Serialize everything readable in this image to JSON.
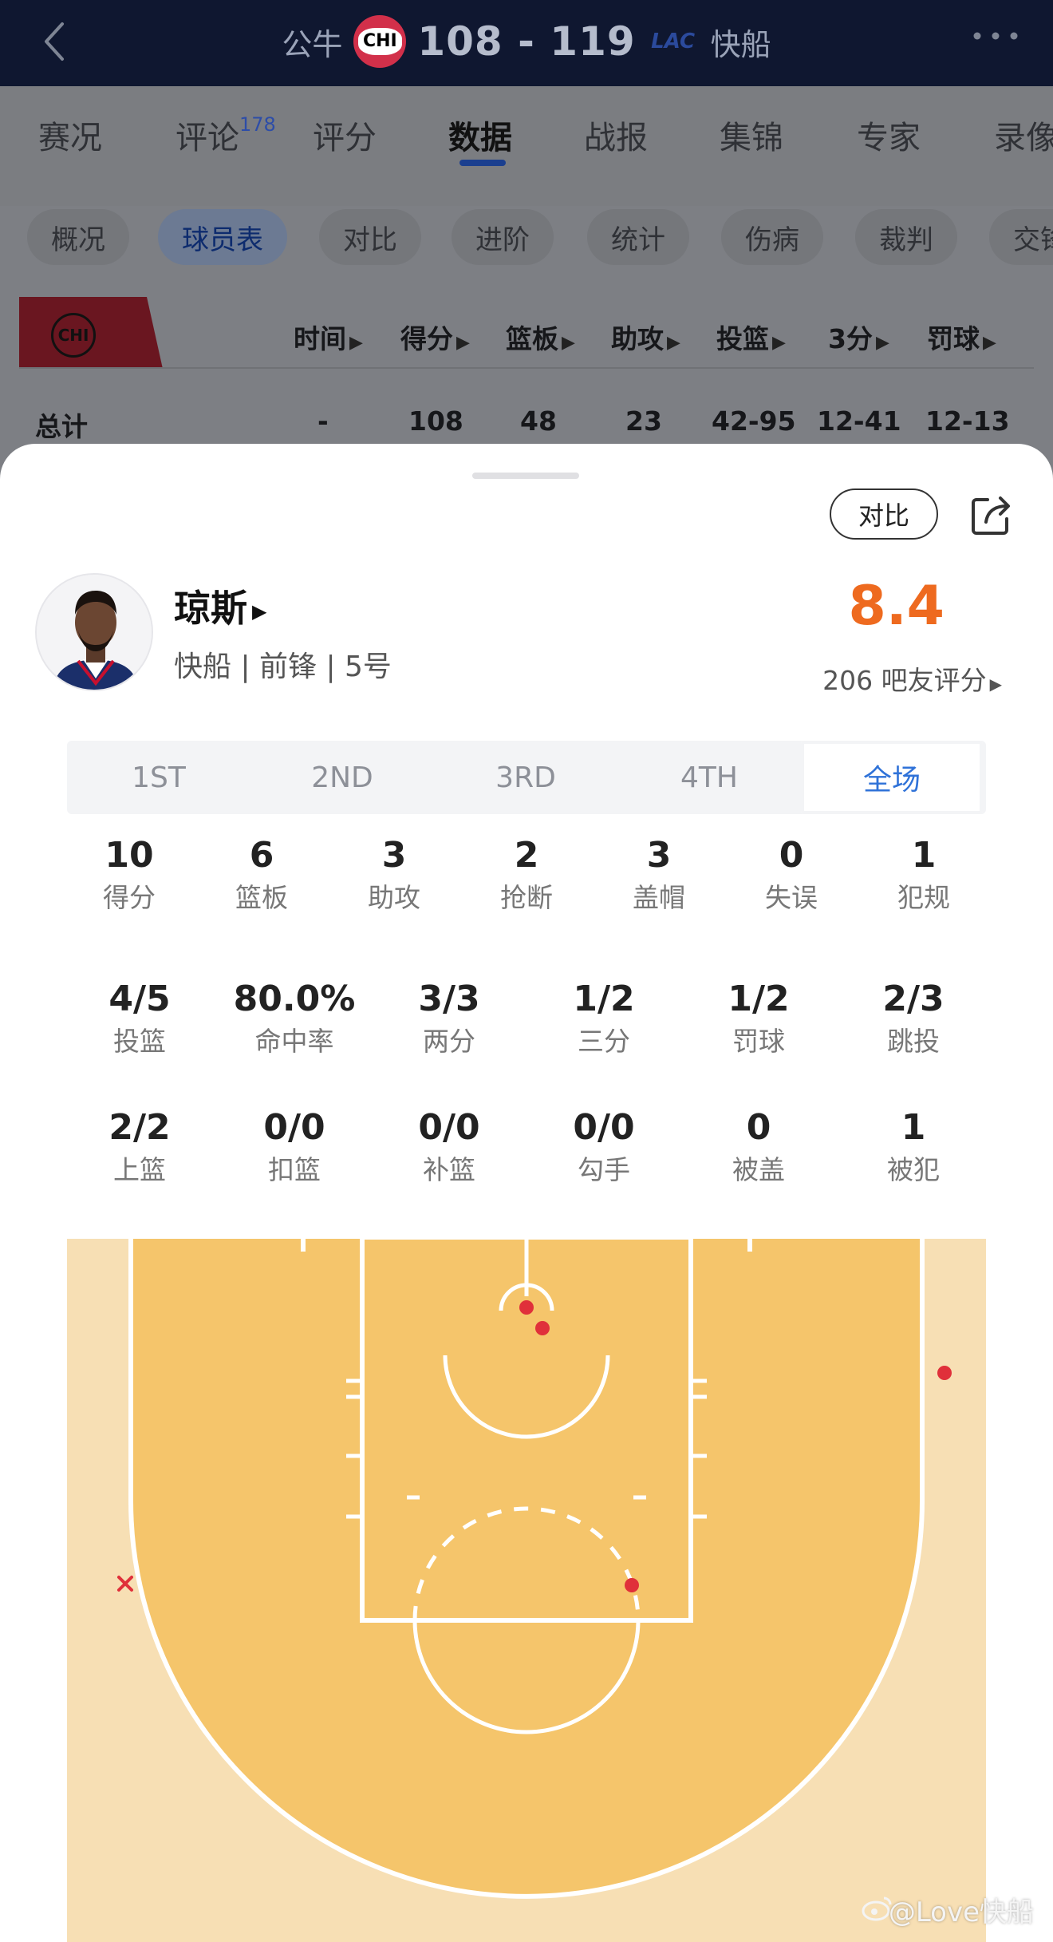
{
  "header": {
    "home_team": "公牛",
    "home_logo": "CHI",
    "score": "108 - 119",
    "away_logo": "LAC",
    "away_team": "快船"
  },
  "main_tabs": [
    {
      "label": "赛况"
    },
    {
      "label": "评论",
      "badge": "178"
    },
    {
      "label": "评分"
    },
    {
      "label": "数据"
    },
    {
      "label": "战报"
    },
    {
      "label": "集锦"
    },
    {
      "label": "专家"
    },
    {
      "label": "录像"
    }
  ],
  "sub_tabs": [
    "概况",
    "球员表",
    "对比",
    "进阶",
    "统计",
    "伤病",
    "裁判",
    "交锋"
  ],
  "box_table": {
    "team_logo": "CHI",
    "columns": [
      "时间",
      "得分",
      "篮板",
      "助攻",
      "投篮",
      "3分",
      "罚球"
    ],
    "total_label": "总计",
    "total_values": [
      "-",
      "108",
      "48",
      "23",
      "42-95",
      "12-41",
      "12-13"
    ]
  },
  "sheet": {
    "compare_label": "对比",
    "player": {
      "name": "琼斯",
      "meta": "快船 | 前锋 | 5号"
    },
    "rating": "8.4",
    "rating_count": "206 吧友评分",
    "periods": [
      "1ST",
      "2ND",
      "3RD",
      "4TH",
      "全场"
    ],
    "active_period": "全场",
    "stats_row1": [
      {
        "value": "10",
        "label": "得分"
      },
      {
        "value": "6",
        "label": "篮板"
      },
      {
        "value": "3",
        "label": "助攻"
      },
      {
        "value": "2",
        "label": "抢断"
      },
      {
        "value": "3",
        "label": "盖帽"
      },
      {
        "value": "0",
        "label": "失误"
      },
      {
        "value": "1",
        "label": "犯规"
      }
    ],
    "stats_row2": [
      {
        "value": "4/5",
        "label": "投篮"
      },
      {
        "value": "80.0%",
        "label": "命中率"
      },
      {
        "value": "3/3",
        "label": "两分"
      },
      {
        "value": "1/2",
        "label": "三分"
      },
      {
        "value": "1/2",
        "label": "罚球"
      },
      {
        "value": "2/3",
        "label": "跳投"
      }
    ],
    "stats_row3": [
      {
        "value": "2/2",
        "label": "上篮"
      },
      {
        "value": "0/0",
        "label": "扣篮"
      },
      {
        "value": "0/0",
        "label": "补篮"
      },
      {
        "value": "0/0",
        "label": "勾手"
      },
      {
        "value": "0",
        "label": "被盖"
      },
      {
        "value": "1",
        "label": "被犯"
      }
    ],
    "shot_chart": {
      "made_color": "#e0303a",
      "missed_color": "#e0303a",
      "made_shots": 4,
      "missed_shots": 1
    }
  },
  "watermark": "@Love快船",
  "colors": {
    "topbar": "#0f1730",
    "rating": "#ee6a1f",
    "active_period": "#2f72d8",
    "court": "#f5c56b",
    "court_outer": "#f7dfb4"
  }
}
